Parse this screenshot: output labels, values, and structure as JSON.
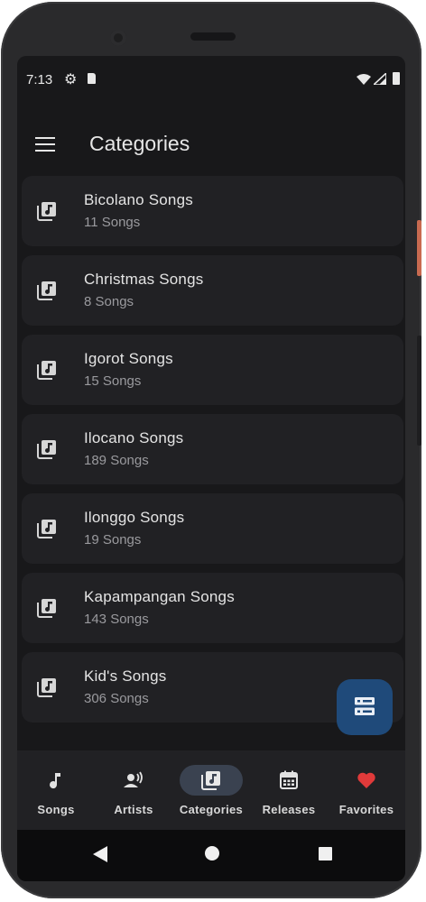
{
  "status_bar": {
    "time": "7:13",
    "icons": [
      "gear-icon",
      "sd-card-icon",
      "wifi-icon",
      "signal-icon",
      "battery-icon"
    ]
  },
  "app_bar": {
    "title": "Categories",
    "menu_icon": "menu-icon"
  },
  "categories": [
    {
      "name": "Bicolano Songs",
      "count": "11 Songs"
    },
    {
      "name": "Christmas Songs",
      "count": "8 Songs"
    },
    {
      "name": "Igorot Songs",
      "count": "15 Songs"
    },
    {
      "name": "Ilocano Songs",
      "count": "189 Songs"
    },
    {
      "name": "Ilonggo Songs",
      "count": "19 Songs"
    },
    {
      "name": "Kapampangan Songs",
      "count": "143 Songs"
    },
    {
      "name": "Kid's Songs",
      "count": "306 Songs"
    }
  ],
  "fab": {
    "icon": "storage-icon"
  },
  "bottom_nav": [
    {
      "label": "Songs",
      "icon": "music-note-icon",
      "active": false
    },
    {
      "label": "Artists",
      "icon": "artist-icon",
      "active": false
    },
    {
      "label": "Categories",
      "icon": "library-music-icon",
      "active": true
    },
    {
      "label": "Releases",
      "icon": "calendar-icon",
      "active": false
    },
    {
      "label": "Favorites",
      "icon": "heart-icon",
      "active": false
    }
  ],
  "colors": {
    "background": "#18181a",
    "card": "#212124",
    "fab": "#1f4a7a",
    "favorite": "#e03a3a",
    "active_pill": "#3a4250"
  }
}
